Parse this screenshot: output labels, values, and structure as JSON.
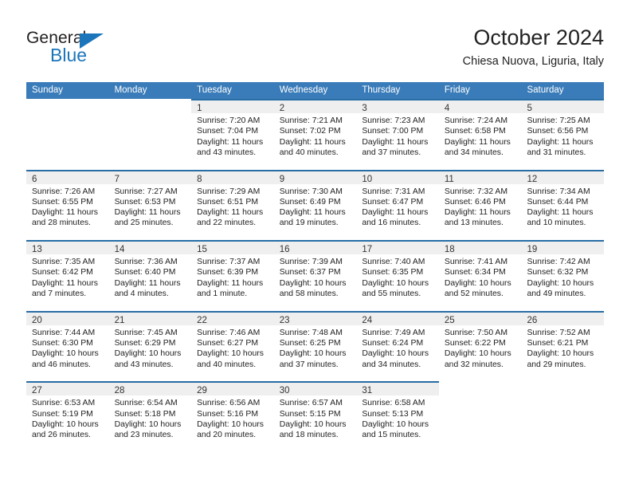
{
  "brand": {
    "name_top": "General",
    "name_bottom": "Blue",
    "accent_color": "#1b75bb"
  },
  "header": {
    "title": "October 2024",
    "subtitle": "Chiesa Nuova, Liguria, Italy"
  },
  "calendar": {
    "header_bg": "#3a7cb9",
    "row_border_color": "#286da4",
    "day_band_bg": "#efefef",
    "weekdays": [
      "Sunday",
      "Monday",
      "Tuesday",
      "Wednesday",
      "Thursday",
      "Friday",
      "Saturday"
    ],
    "weeks": [
      [
        {
          "day": "",
          "lines": []
        },
        {
          "day": "",
          "lines": []
        },
        {
          "day": "1",
          "lines": [
            "Sunrise: 7:20 AM",
            "Sunset: 7:04 PM",
            "Daylight: 11 hours",
            "and 43 minutes."
          ]
        },
        {
          "day": "2",
          "lines": [
            "Sunrise: 7:21 AM",
            "Sunset: 7:02 PM",
            "Daylight: 11 hours",
            "and 40 minutes."
          ]
        },
        {
          "day": "3",
          "lines": [
            "Sunrise: 7:23 AM",
            "Sunset: 7:00 PM",
            "Daylight: 11 hours",
            "and 37 minutes."
          ]
        },
        {
          "day": "4",
          "lines": [
            "Sunrise: 7:24 AM",
            "Sunset: 6:58 PM",
            "Daylight: 11 hours",
            "and 34 minutes."
          ]
        },
        {
          "day": "5",
          "lines": [
            "Sunrise: 7:25 AM",
            "Sunset: 6:56 PM",
            "Daylight: 11 hours",
            "and 31 minutes."
          ]
        }
      ],
      [
        {
          "day": "6",
          "lines": [
            "Sunrise: 7:26 AM",
            "Sunset: 6:55 PM",
            "Daylight: 11 hours",
            "and 28 minutes."
          ]
        },
        {
          "day": "7",
          "lines": [
            "Sunrise: 7:27 AM",
            "Sunset: 6:53 PM",
            "Daylight: 11 hours",
            "and 25 minutes."
          ]
        },
        {
          "day": "8",
          "lines": [
            "Sunrise: 7:29 AM",
            "Sunset: 6:51 PM",
            "Daylight: 11 hours",
            "and 22 minutes."
          ]
        },
        {
          "day": "9",
          "lines": [
            "Sunrise: 7:30 AM",
            "Sunset: 6:49 PM",
            "Daylight: 11 hours",
            "and 19 minutes."
          ]
        },
        {
          "day": "10",
          "lines": [
            "Sunrise: 7:31 AM",
            "Sunset: 6:47 PM",
            "Daylight: 11 hours",
            "and 16 minutes."
          ]
        },
        {
          "day": "11",
          "lines": [
            "Sunrise: 7:32 AM",
            "Sunset: 6:46 PM",
            "Daylight: 11 hours",
            "and 13 minutes."
          ]
        },
        {
          "day": "12",
          "lines": [
            "Sunrise: 7:34 AM",
            "Sunset: 6:44 PM",
            "Daylight: 11 hours",
            "and 10 minutes."
          ]
        }
      ],
      [
        {
          "day": "13",
          "lines": [
            "Sunrise: 7:35 AM",
            "Sunset: 6:42 PM",
            "Daylight: 11 hours",
            "and 7 minutes."
          ]
        },
        {
          "day": "14",
          "lines": [
            "Sunrise: 7:36 AM",
            "Sunset: 6:40 PM",
            "Daylight: 11 hours",
            "and 4 minutes."
          ]
        },
        {
          "day": "15",
          "lines": [
            "Sunrise: 7:37 AM",
            "Sunset: 6:39 PM",
            "Daylight: 11 hours",
            "and 1 minute."
          ]
        },
        {
          "day": "16",
          "lines": [
            "Sunrise: 7:39 AM",
            "Sunset: 6:37 PM",
            "Daylight: 10 hours",
            "and 58 minutes."
          ]
        },
        {
          "day": "17",
          "lines": [
            "Sunrise: 7:40 AM",
            "Sunset: 6:35 PM",
            "Daylight: 10 hours",
            "and 55 minutes."
          ]
        },
        {
          "day": "18",
          "lines": [
            "Sunrise: 7:41 AM",
            "Sunset: 6:34 PM",
            "Daylight: 10 hours",
            "and 52 minutes."
          ]
        },
        {
          "day": "19",
          "lines": [
            "Sunrise: 7:42 AM",
            "Sunset: 6:32 PM",
            "Daylight: 10 hours",
            "and 49 minutes."
          ]
        }
      ],
      [
        {
          "day": "20",
          "lines": [
            "Sunrise: 7:44 AM",
            "Sunset: 6:30 PM",
            "Daylight: 10 hours",
            "and 46 minutes."
          ]
        },
        {
          "day": "21",
          "lines": [
            "Sunrise: 7:45 AM",
            "Sunset: 6:29 PM",
            "Daylight: 10 hours",
            "and 43 minutes."
          ]
        },
        {
          "day": "22",
          "lines": [
            "Sunrise: 7:46 AM",
            "Sunset: 6:27 PM",
            "Daylight: 10 hours",
            "and 40 minutes."
          ]
        },
        {
          "day": "23",
          "lines": [
            "Sunrise: 7:48 AM",
            "Sunset: 6:25 PM",
            "Daylight: 10 hours",
            "and 37 minutes."
          ]
        },
        {
          "day": "24",
          "lines": [
            "Sunrise: 7:49 AM",
            "Sunset: 6:24 PM",
            "Daylight: 10 hours",
            "and 34 minutes."
          ]
        },
        {
          "day": "25",
          "lines": [
            "Sunrise: 7:50 AM",
            "Sunset: 6:22 PM",
            "Daylight: 10 hours",
            "and 32 minutes."
          ]
        },
        {
          "day": "26",
          "lines": [
            "Sunrise: 7:52 AM",
            "Sunset: 6:21 PM",
            "Daylight: 10 hours",
            "and 29 minutes."
          ]
        }
      ],
      [
        {
          "day": "27",
          "lines": [
            "Sunrise: 6:53 AM",
            "Sunset: 5:19 PM",
            "Daylight: 10 hours",
            "and 26 minutes."
          ]
        },
        {
          "day": "28",
          "lines": [
            "Sunrise: 6:54 AM",
            "Sunset: 5:18 PM",
            "Daylight: 10 hours",
            "and 23 minutes."
          ]
        },
        {
          "day": "29",
          "lines": [
            "Sunrise: 6:56 AM",
            "Sunset: 5:16 PM",
            "Daylight: 10 hours",
            "and 20 minutes."
          ]
        },
        {
          "day": "30",
          "lines": [
            "Sunrise: 6:57 AM",
            "Sunset: 5:15 PM",
            "Daylight: 10 hours",
            "and 18 minutes."
          ]
        },
        {
          "day": "31",
          "lines": [
            "Sunrise: 6:58 AM",
            "Sunset: 5:13 PM",
            "Daylight: 10 hours",
            "and 15 minutes."
          ]
        },
        {
          "day": "",
          "lines": []
        },
        {
          "day": "",
          "lines": []
        }
      ]
    ]
  }
}
